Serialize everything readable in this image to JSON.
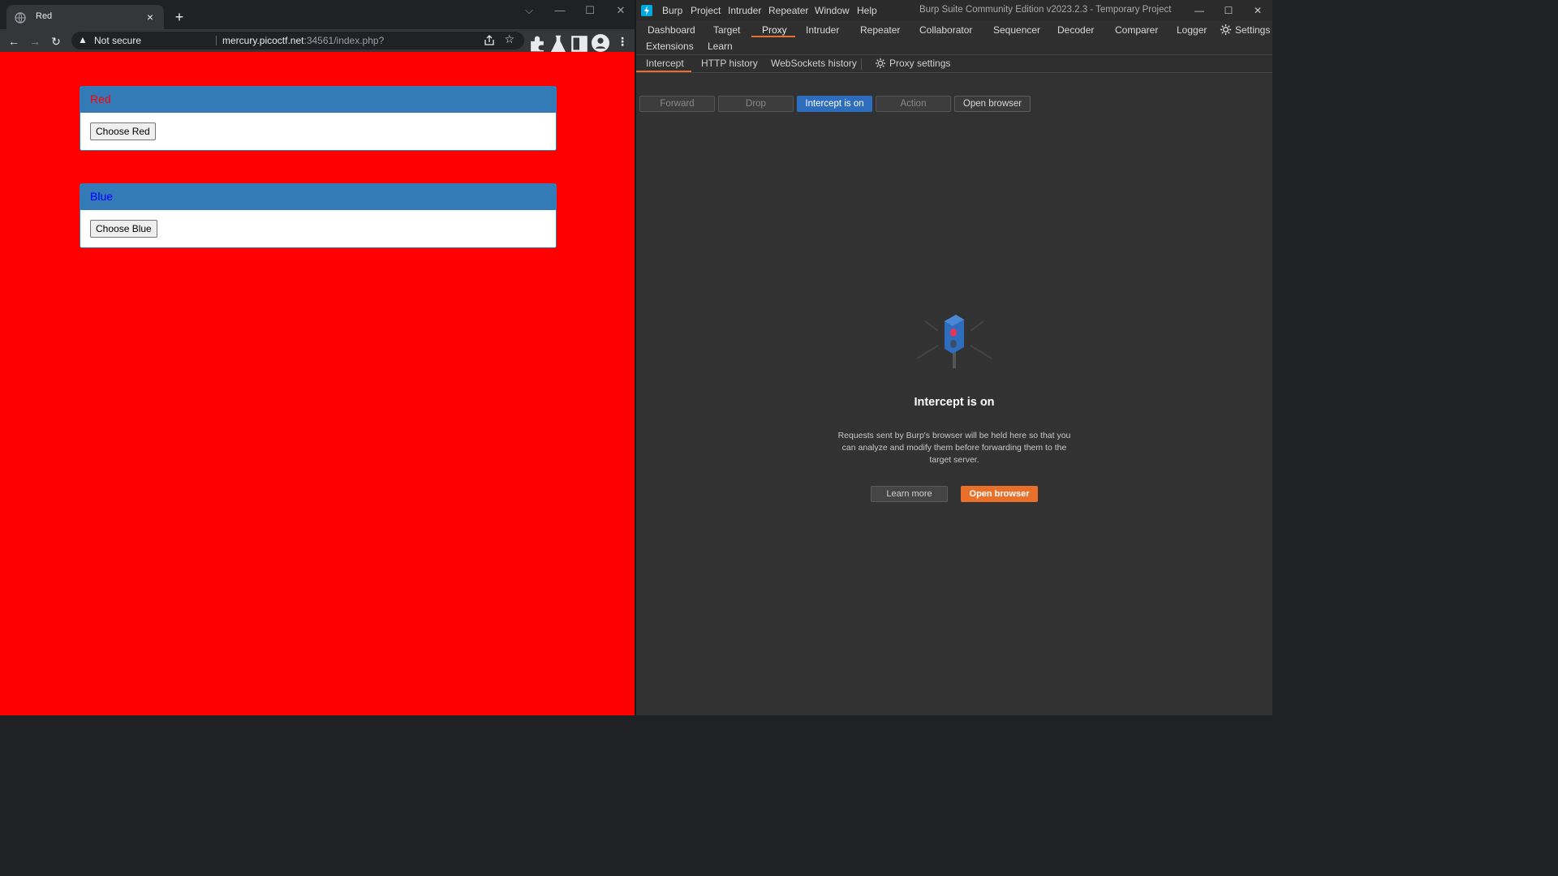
{
  "chrome": {
    "tab_title": "Red",
    "tab_close": "×",
    "new_tab": "+",
    "window_controls": {
      "dropdown": "⌵",
      "minimize": "—",
      "maximize": "☐",
      "close": "✕"
    },
    "nav": {
      "back": "←",
      "forward": "→",
      "reload": "↻"
    },
    "omnibox": {
      "security_label": "Not secure",
      "url_host": "mercury.picoctf.net",
      "url_rest": ":34561/index.php?"
    },
    "toolbar_icons": [
      "share-icon",
      "star-icon",
      "extensions-icon",
      "labs-icon",
      "side-panel-icon",
      "profile-icon",
      "menu-icon"
    ]
  },
  "page": {
    "background_color": "#ff0000",
    "panels": [
      {
        "heading": "Red",
        "heading_color": "#ff0000",
        "button_label": "Choose Red"
      },
      {
        "heading": "Blue",
        "heading_color": "#0000ff",
        "button_label": "Choose Blue"
      }
    ]
  },
  "burp": {
    "menu": [
      "Burp",
      "Project",
      "Intruder",
      "Repeater",
      "Window",
      "Help"
    ],
    "window_title": "Burp Suite Community Edition v2023.2.3 - Temporary Project",
    "main_tabs_row1": [
      "Dashboard",
      "Target",
      "Proxy",
      "Intruder",
      "Repeater",
      "Collaborator",
      "Sequencer",
      "Decoder",
      "Comparer",
      "Logger"
    ],
    "settings_label": "Settings",
    "main_tabs_row2": [
      "Extensions",
      "Learn"
    ],
    "active_main_tab": "Proxy",
    "sub_tabs": [
      "Intercept",
      "HTTP history",
      "WebSockets history"
    ],
    "proxy_settings_label": "Proxy settings",
    "active_sub_tab": "Intercept",
    "intercept_buttons": {
      "forward": "Forward",
      "drop": "Drop",
      "intercept_toggle": "Intercept is on",
      "action": "Action",
      "open_browser": "Open browser"
    },
    "empty_state": {
      "title": "Intercept is on",
      "description": "Requests sent by Burp's browser will be held here so that you can analyze and modify them before forwarding them to the target server.",
      "learn_more": "Learn more",
      "open_browser": "Open browser"
    },
    "accent_color": "#e8702a",
    "toggle_on_color": "#2e6dbd"
  }
}
